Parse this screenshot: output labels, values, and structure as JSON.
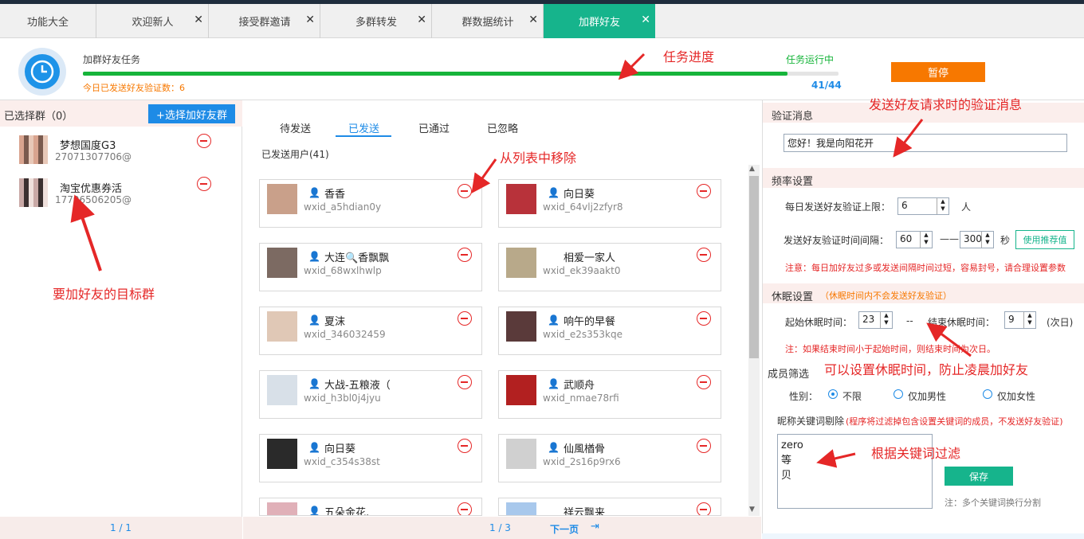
{
  "tabs": [
    {
      "label": "功能大全"
    },
    {
      "label": "欢迎新人",
      "close": "✕"
    },
    {
      "label": "接受群邀请",
      "close": "✕"
    },
    {
      "label": "多群转发",
      "close": "✕"
    },
    {
      "label": "群数据统计",
      "close": "✕"
    },
    {
      "label": "加群好友",
      "close": "✕"
    }
  ],
  "task": {
    "title": "加群好友任务",
    "status": "任务运行中",
    "sent_today": "今日已发送好友验证数：6",
    "progress_text": "41/44",
    "progress": 0.932,
    "pause": "暂停"
  },
  "annotations": {
    "progress": "任务进度",
    "remove": "从列表中移除",
    "target": "要加好友的目标群",
    "verify": "发送好友请求时的验证消息",
    "sleep": "可以设置休眠时间，防止凌晨加好友",
    "keyword": "根据关键词过滤"
  },
  "left": {
    "header": "已选择群（0）",
    "add_button": "+选择加好友群",
    "groups": [
      {
        "name": "梦想国度G3",
        "id": "27071307706@"
      },
      {
        "name": "淘宝优惠券活",
        "id": "17796506205@"
      }
    ],
    "pager": "1 / 1"
  },
  "mid": {
    "tabs": [
      "待发送",
      "已发送",
      "已通过",
      "已忽略"
    ],
    "sent_count": "已发送用户(41)",
    "users": [
      {
        "name": "香香",
        "id": "wxid_a5hdian0y",
        "gender": "female"
      },
      {
        "name": "向日葵",
        "id": "wxid_64vlj2zfyr8",
        "gender": "female"
      },
      {
        "name": "大连🔍香飘飘",
        "id": "wxid_68wxlhwlp",
        "gender": "female"
      },
      {
        "name": "相爱一家人",
        "id": "wxid_ek39aakt0",
        "gender": ""
      },
      {
        "name": "夏沫",
        "id": "wxid_346032459",
        "gender": "female"
      },
      {
        "name": "响午的早餐",
        "id": "wxid_e2s353kqe",
        "gender": "female"
      },
      {
        "name": "大战-五粮液（",
        "id": "wxid_h3bl0j4jyu",
        "gender": "male"
      },
      {
        "name": "武顺舟",
        "id": "wxid_nmae78rfi",
        "gender": "male"
      },
      {
        "name": "向日葵",
        "id": "wxid_c354s38st",
        "gender": "female"
      },
      {
        "name": "仙風楢骨",
        "id": "wxid_2s16p9rx6",
        "gender": "male"
      },
      {
        "name": "五朵金花,",
        "id": "",
        "gender": "female"
      },
      {
        "name": "祥云飘来",
        "id": "",
        "gender": ""
      }
    ],
    "pager": "1 / 3",
    "next": "下一页",
    "last_icon": "⇥"
  },
  "right": {
    "verify_head": "验证消息",
    "verify_msg": "您好！我是向阳花开",
    "freq_head": "频率设置",
    "daily_label": "每日发送好友验证上限：",
    "daily_value": "6",
    "daily_unit": "人",
    "interval_label": "发送好友验证时间间隔：",
    "interval_min": "60",
    "interval_dash": "——",
    "interval_max": "300",
    "interval_unit": "秒",
    "recommend": "使用推荐值",
    "freq_note": "注意：每日加好友过多或发送间隔时间过短，容易封号，请合理设置参数",
    "sleep_head": "休眠设置",
    "sleep_hint": "（休眠时间内不会发送好友验证）",
    "sleep_start_label": "起始休眠时间：",
    "sleep_start": "23",
    "sleep_dash": "--",
    "sleep_end_label": "结束休眠时间：",
    "sleep_end": "9",
    "next_day": "(次日)",
    "sleep_note": "注：如果结束时间小于起始时间，则结束时间为次日。",
    "filter_head": "成员筛选",
    "gender_label": "性别：",
    "gender_opts": [
      "不限",
      "仅加男性",
      "仅加女性"
    ],
    "kw_label": "昵称关键词剔除",
    "kw_hint": "(程序将过滤掉包含设置关键词的成员，不发送好友验证)",
    "keywords": [
      "zero",
      "等",
      "贝"
    ],
    "save": "保存",
    "kw_note": "注：多个关键词换行分割"
  },
  "colors": {
    "accent": "#16b48c",
    "blue": "#1e8be6",
    "orange": "#f77800",
    "red": "#e52727"
  }
}
